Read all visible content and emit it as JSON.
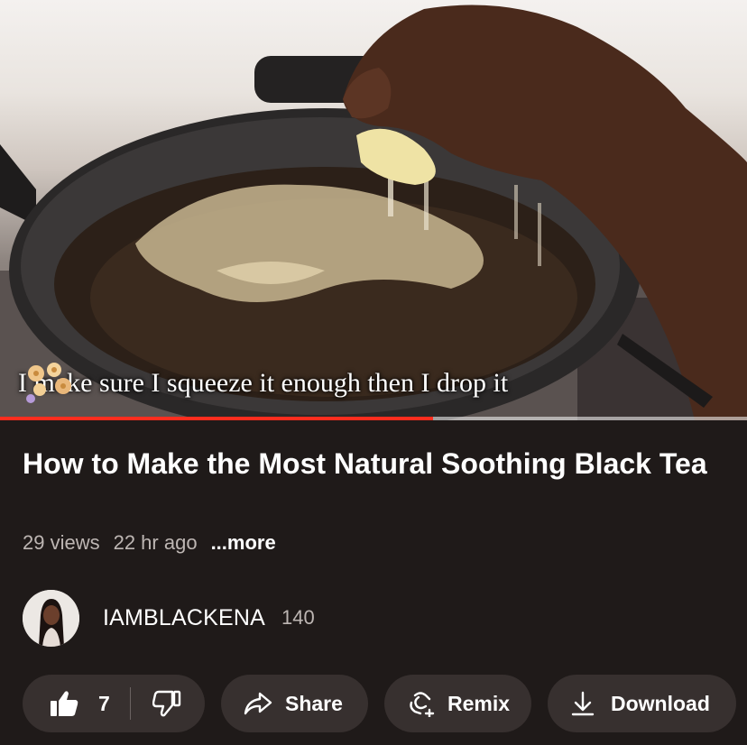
{
  "video": {
    "caption": "I make sure I squeeze it enough then I drop it",
    "progress_fraction": 0.58
  },
  "title": "How to Make the Most Natural Soothing Black Tea",
  "meta": {
    "views": "29 views",
    "time_ago": "22 hr ago",
    "more_label": "...more"
  },
  "channel": {
    "name": "IAMBLACKENA",
    "subscribers": "140"
  },
  "actions": {
    "like_count": "7",
    "share_label": "Share",
    "remix_label": "Remix",
    "download_label": "Download"
  },
  "colors": {
    "background": "#1f1a19",
    "pill": "#37302f",
    "progress": "#ff2d1e",
    "secondary_text": "#bdb6b3"
  },
  "icons": [
    "thumbs-up-icon",
    "thumbs-down-icon",
    "share-arrow-icon",
    "remix-icon",
    "download-icon",
    "flower-icon"
  ]
}
